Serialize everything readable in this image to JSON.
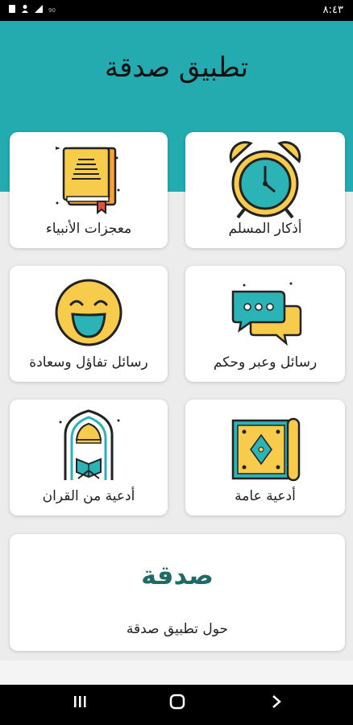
{
  "status_bar": {
    "time": "٨:٤٣",
    "tiny": "90"
  },
  "header": {
    "title": "تطبيق صدقة"
  },
  "cards": [
    {
      "label": "أذكار المسلم",
      "icon": "alarm-clock-icon"
    },
    {
      "label": "معجزات الأنبياء",
      "icon": "book-icon"
    },
    {
      "label": "رسائل وعبر وحكم",
      "icon": "chat-bubbles-icon"
    },
    {
      "label": "رسائل تفاؤل وسعادة",
      "icon": "laughing-face-icon"
    },
    {
      "label": "أدعية عامة",
      "icon": "prayer-rug-icon"
    },
    {
      "label": "أدعية من القران",
      "icon": "mosque-quran-icon"
    }
  ],
  "about": {
    "logo": "صدقة",
    "label": "حول تطبيق صدقة"
  },
  "colors": {
    "accent": "#24abb0",
    "yellow": "#f7cc4c",
    "logo": "#1e6b63"
  }
}
